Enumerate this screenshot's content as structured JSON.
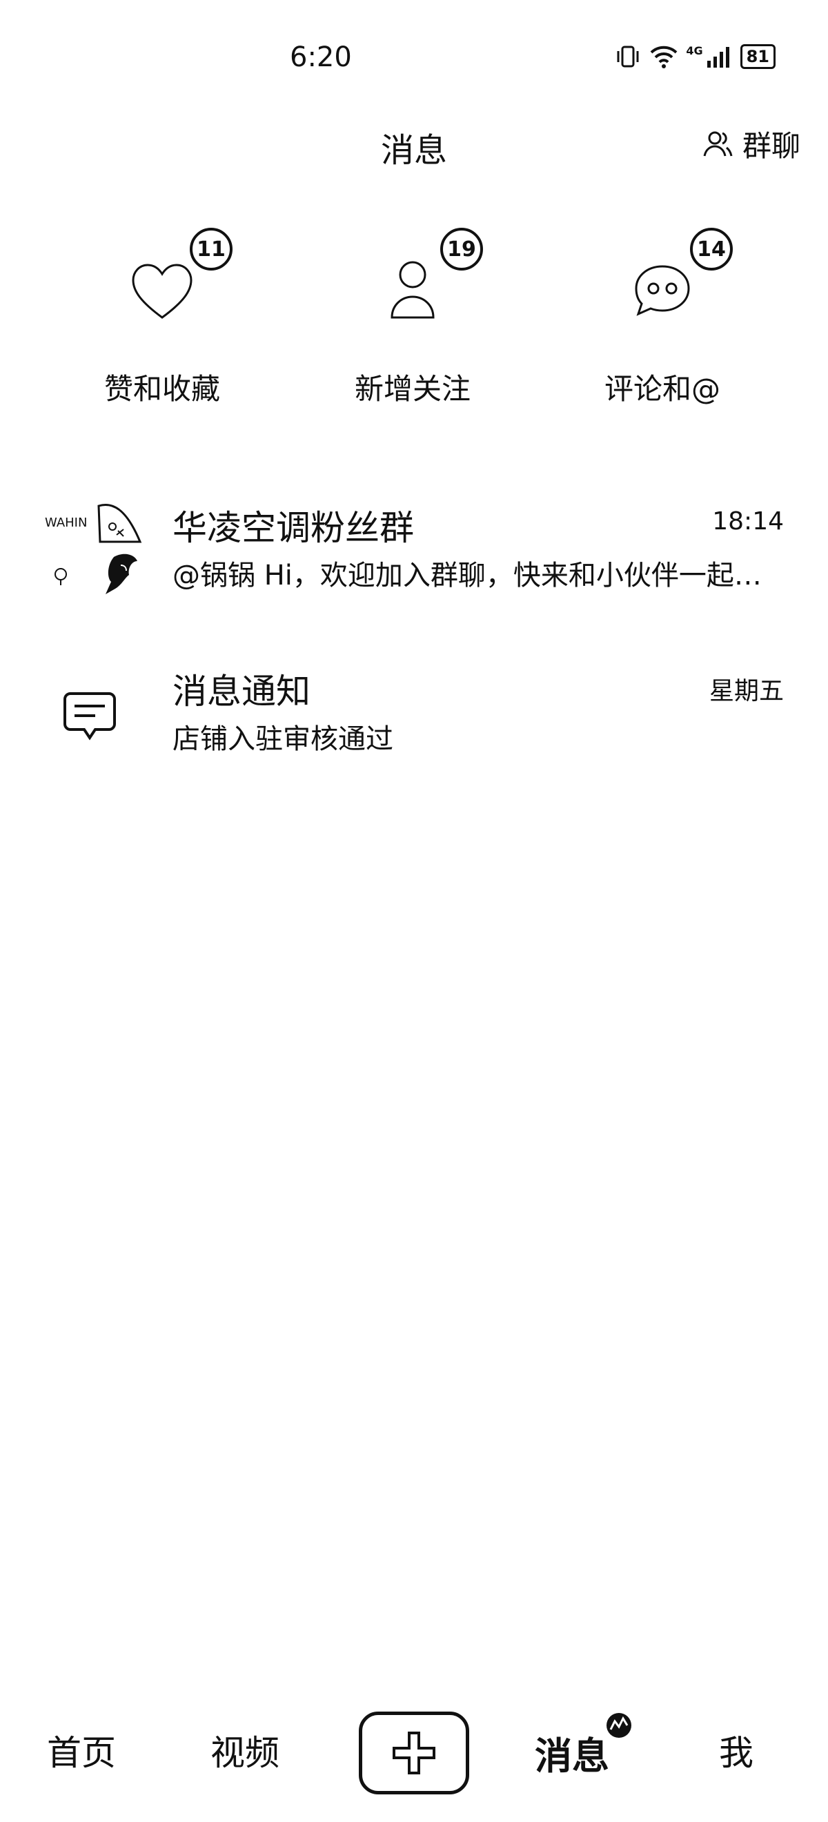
{
  "status_bar": {
    "time": "6:20",
    "battery": "81",
    "network": "4G"
  },
  "header": {
    "title": "消息",
    "group_chat_label": "群聊"
  },
  "categories": [
    {
      "label": "赞和收藏",
      "badge": "11",
      "icon": "heart-icon"
    },
    {
      "label": "新增关注",
      "badge": "19",
      "icon": "person-icon"
    },
    {
      "label": "评论和@",
      "badge": "14",
      "icon": "chat-bubble-icon"
    }
  ],
  "conversations": [
    {
      "name": "华凌空调粉丝群",
      "time": "18:14",
      "preview": "@锅锅 Hi，欢迎加入群聊，快来和小伙伴一起聊天吧",
      "avatar_caption": "WAHIN"
    },
    {
      "name": "消息通知",
      "time": "星期五",
      "preview": "店铺入驻审核通过"
    }
  ],
  "bottom_nav": {
    "home": "首页",
    "video": "视频",
    "messages": "消息",
    "me": "我"
  }
}
